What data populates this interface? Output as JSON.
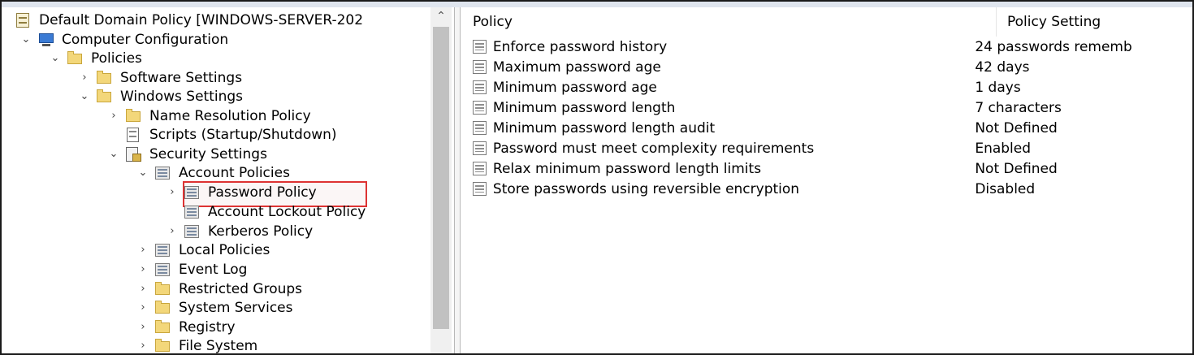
{
  "tree": {
    "root": "Default Domain Policy [WINDOWS-SERVER-202",
    "computer_configuration": "Computer Configuration",
    "policies": "Policies",
    "software_settings": "Software Settings",
    "windows_settings": "Windows Settings",
    "name_resolution_policy": "Name Resolution Policy",
    "scripts": "Scripts (Startup/Shutdown)",
    "security_settings": "Security Settings",
    "account_policies": "Account Policies",
    "password_policy": "Password Policy",
    "account_lockout_policy": "Account Lockout Policy",
    "kerberos_policy": "Kerberos Policy",
    "local_policies": "Local Policies",
    "event_log": "Event Log",
    "restricted_groups": "Restricted Groups",
    "system_services": "System Services",
    "registry": "Registry",
    "file_system": "File System",
    "selected": "Password Policy"
  },
  "list": {
    "columns": {
      "policy": "Policy",
      "setting": "Policy Setting"
    },
    "rows": [
      {
        "policy": "Enforce password history",
        "setting": "24 passwords rememb"
      },
      {
        "policy": "Maximum password age",
        "setting": "42 days"
      },
      {
        "policy": "Minimum password age",
        "setting": "1 days"
      },
      {
        "policy": "Minimum password length",
        "setting": "7 characters"
      },
      {
        "policy": "Minimum password length audit",
        "setting": "Not Defined"
      },
      {
        "policy": "Password must meet complexity requirements",
        "setting": "Enabled"
      },
      {
        "policy": "Relax minimum password length limits",
        "setting": "Not Defined"
      },
      {
        "policy": "Store passwords using reversible encryption",
        "setting": "Disabled"
      }
    ]
  },
  "icons": {
    "expanded": "chevron-down-icon",
    "collapsed": "chevron-right-icon",
    "highlight_color": "#d33333"
  }
}
